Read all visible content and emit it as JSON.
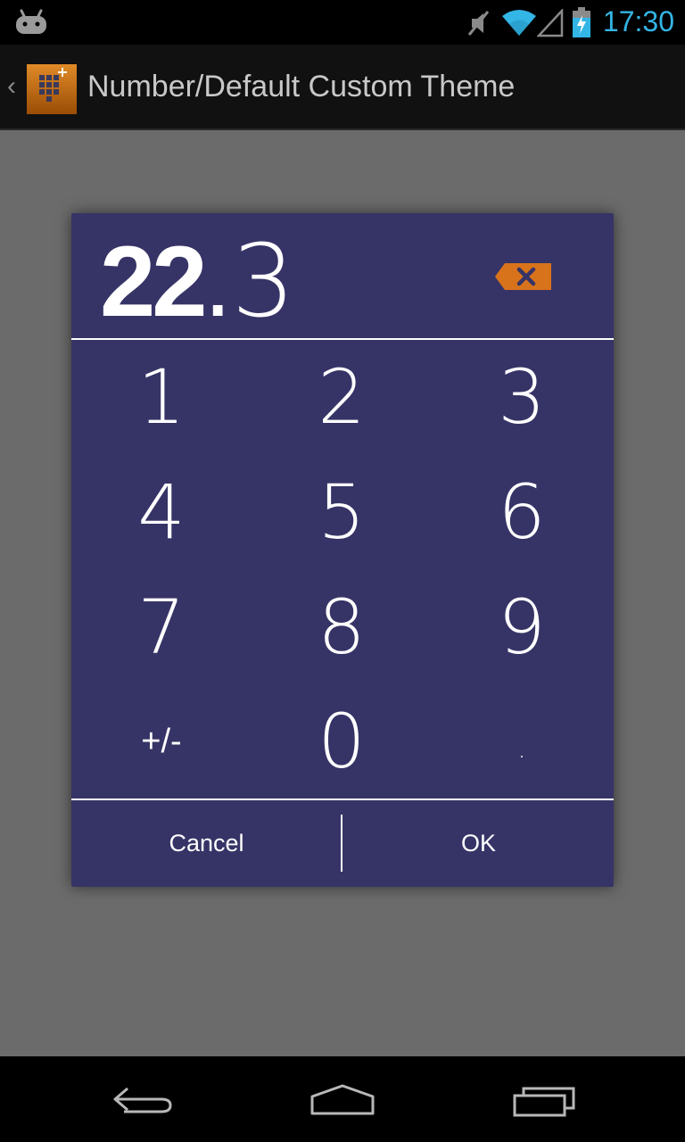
{
  "status_bar": {
    "time": "17:30",
    "icons": [
      "android-icon",
      "mute-icon",
      "wifi-icon",
      "signal-icon",
      "battery-charging-icon"
    ],
    "accent_color": "#33b5e5"
  },
  "action_bar": {
    "title": "Number/Default Custom Theme",
    "icons": [
      "up-caret-icon",
      "app-keypad-icon"
    ]
  },
  "dialog": {
    "colors": {
      "background": "#363466",
      "backspace": "#d9731b"
    },
    "display": {
      "whole": "22",
      "decimal_point": ".",
      "fraction": "3"
    },
    "keys": [
      {
        "label": "1",
        "name": "key-1"
      },
      {
        "label": "2",
        "name": "key-2"
      },
      {
        "label": "3",
        "name": "key-3"
      },
      {
        "label": "4",
        "name": "key-4"
      },
      {
        "label": "5",
        "name": "key-5"
      },
      {
        "label": "6",
        "name": "key-6"
      },
      {
        "label": "7",
        "name": "key-7"
      },
      {
        "label": "8",
        "name": "key-8"
      },
      {
        "label": "9",
        "name": "key-9"
      },
      {
        "label": "+/-",
        "name": "key-plus-minus"
      },
      {
        "label": "0",
        "name": "key-0"
      },
      {
        "label": ".",
        "name": "key-decimal"
      }
    ],
    "cancel_label": "Cancel",
    "ok_label": "OK"
  },
  "nav_bar": {
    "icons": [
      "back-icon",
      "home-icon",
      "recents-icon"
    ]
  }
}
